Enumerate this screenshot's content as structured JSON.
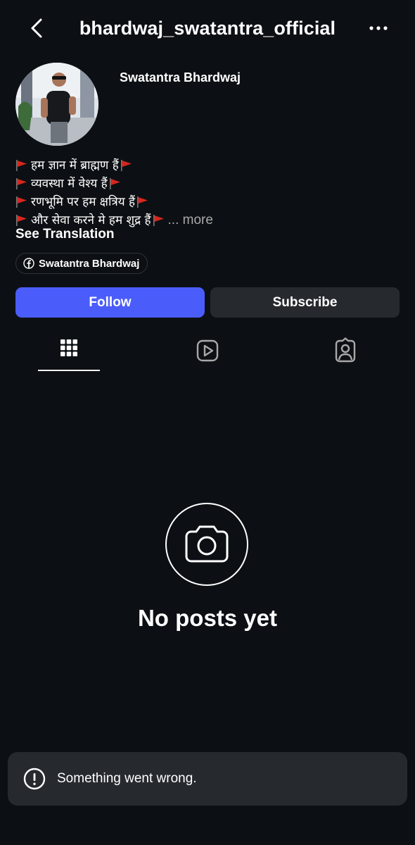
{
  "header": {
    "username": "bhardwaj_swatantra_official",
    "back_icon": "chevron-left-icon",
    "more_icon": "ellipsis-icon"
  },
  "profile": {
    "display_name": "Swatantra Bhardwaj",
    "bio_lines": [
      "हम ज्ञान में ब्राह्मण हैं",
      "व्यवस्था में वेश्य हैं",
      "रणभूमि पर हम क्षत्रिय हैं",
      "और सेवा करने मे हम शुद्र हैं"
    ],
    "bio_more": "... more",
    "see_translation": "See Translation",
    "link_label": "Swatantra Bhardwaj",
    "link_icon": "facebook-icon",
    "flag_color": "#d7261e"
  },
  "actions": {
    "follow": "Follow",
    "subscribe": "Subscribe",
    "follow_color": "#4a5dfa"
  },
  "tabs": [
    {
      "name": "posts",
      "icon": "grid-icon",
      "selected": true
    },
    {
      "name": "reels",
      "icon": "reels-icon",
      "selected": false
    },
    {
      "name": "tagged",
      "icon": "tagged-icon",
      "selected": false
    }
  ],
  "empty_state": {
    "icon": "camera-icon",
    "title": "No posts yet"
  },
  "toast": {
    "icon": "exclamation-icon",
    "message": "Something went wrong."
  }
}
